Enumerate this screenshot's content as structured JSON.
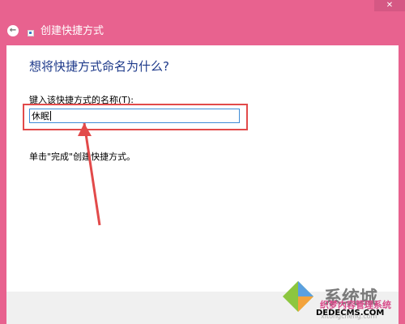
{
  "titlebar": {
    "close_label": "✕",
    "back_label": "←",
    "title": "创建快捷方式"
  },
  "content": {
    "heading": "想将快捷方式命名为什么?",
    "field_label": "键入该快捷方式的名称(T):",
    "input_value": "休眠",
    "hint": "单击\"完成\"创建快捷方式。"
  },
  "watermark": {
    "brand_text": "系统城",
    "brand_sub": "织梦内容管理系统",
    "url": "DEDECMS.COM",
    "url_small": "xitongcheng.com"
  },
  "colors": {
    "window_frame": "#e8628f",
    "heading": "#1e3a8a",
    "highlight": "#e24a4a",
    "input_border": "#3f8cd7"
  }
}
